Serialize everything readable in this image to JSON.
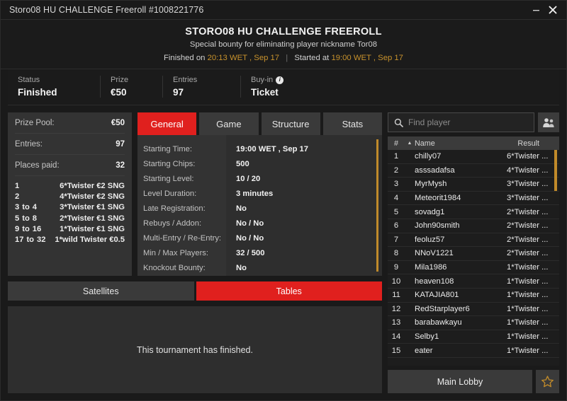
{
  "window": {
    "title": "Storo08 HU CHALLENGE Freeroll #1008221776",
    "minimize_label": "minimize",
    "close_label": "close"
  },
  "header": {
    "title": "STORO08 HU CHALLENGE FREEROLL",
    "subtitle": "Special bounty for eliminating player nickname Tor08",
    "finished_prefix": "Finished on",
    "finished_value": "20:13 WET , Sep 17",
    "separator": "|",
    "started_prefix": "Started at",
    "started_value": "19:00 WET , Sep 17"
  },
  "status_strip": [
    {
      "label": "Status",
      "value": "Finished",
      "has_info": false
    },
    {
      "label": "Prize",
      "value": "€50",
      "has_info": false
    },
    {
      "label": "Entries",
      "value": "97",
      "has_info": false
    },
    {
      "label": "Buy-in",
      "value": "Ticket",
      "has_info": true
    }
  ],
  "prize_panel": {
    "rows": [
      {
        "key": "Prize Pool:",
        "value": "€50"
      },
      {
        "key": "Entries:",
        "value": "97"
      },
      {
        "key": "Places paid:",
        "value": "32"
      }
    ],
    "payouts": [
      {
        "from": "1",
        "to_word": "",
        "to": "",
        "prize": "6*Twister €2 SNG"
      },
      {
        "from": "2",
        "to_word": "",
        "to": "",
        "prize": "4*Twister €2 SNG"
      },
      {
        "from": "3",
        "to_word": "to",
        "to": "4",
        "prize": "3*Twister €1 SNG"
      },
      {
        "from": "5",
        "to_word": "to",
        "to": "8",
        "prize": "2*Twister €1 SNG"
      },
      {
        "from": "9",
        "to_word": "to",
        "to": "16",
        "prize": "1*Twister €1 SNG"
      },
      {
        "from": "17",
        "to_word": "to",
        "to": "32",
        "prize": "1*wild Twister €0.5"
      }
    ]
  },
  "tabs": [
    {
      "label": "General",
      "active": true
    },
    {
      "label": "Game",
      "active": false
    },
    {
      "label": "Structure",
      "active": false
    },
    {
      "label": "Stats",
      "active": false
    }
  ],
  "details": [
    {
      "label": "Starting Time:",
      "value": "19:00 WET , Sep 17"
    },
    {
      "label": "Starting Chips:",
      "value": "500"
    },
    {
      "label": "Starting Level:",
      "value": "10 / 20"
    },
    {
      "label": "Level Duration:",
      "value": "3 minutes"
    },
    {
      "label": "Late Registration:",
      "value": "No"
    },
    {
      "label": "Rebuys / Addon:",
      "value": "No / No"
    },
    {
      "label": "Multi-Entry / Re-Entry:",
      "value": "No / No"
    },
    {
      "label": "Min / Max Players:",
      "value": "32 / 500"
    },
    {
      "label": "Knockout Bounty:",
      "value": "No"
    }
  ],
  "sub_tabs": [
    {
      "label": "Satellites",
      "active": false
    },
    {
      "label": "Tables",
      "active": true
    }
  ],
  "tables_panel": {
    "message": "This tournament has finished."
  },
  "search": {
    "placeholder": "Find player",
    "value": ""
  },
  "player_table": {
    "headers": {
      "num": "#",
      "sort_arrow": "▲",
      "name": "Name",
      "result": "Result"
    },
    "rows": [
      {
        "num": "1",
        "name": "chilly07",
        "result": "6*Twister ..."
      },
      {
        "num": "2",
        "name": "asssadafsa",
        "result": "4*Twister ..."
      },
      {
        "num": "3",
        "name": "MyrMysh",
        "result": "3*Twister ..."
      },
      {
        "num": "4",
        "name": "Meteorit1984",
        "result": "3*Twister ..."
      },
      {
        "num": "5",
        "name": "sovadg1",
        "result": "2*Twister ..."
      },
      {
        "num": "6",
        "name": "John90smith",
        "result": "2*Twister ..."
      },
      {
        "num": "7",
        "name": "feoluz57",
        "result": "2*Twister ..."
      },
      {
        "num": "8",
        "name": "NNoV1221",
        "result": "2*Twister ..."
      },
      {
        "num": "9",
        "name": "Mila1986",
        "result": "1*Twister ..."
      },
      {
        "num": "10",
        "name": "heaven108",
        "result": "1*Twister ..."
      },
      {
        "num": "11",
        "name": "KATAJIA801",
        "result": "1*Twister ..."
      },
      {
        "num": "12",
        "name": "RedStarplayer6",
        "result": "1*Twister ..."
      },
      {
        "num": "13",
        "name": "barabawkayu",
        "result": "1*Twister ..."
      },
      {
        "num": "14",
        "name": "Selby1",
        "result": "1*Twister ..."
      },
      {
        "num": "15",
        "name": "eater",
        "result": "1*Twister ..."
      }
    ]
  },
  "footer": {
    "lobby_label": "Main Lobby",
    "favourite_icon": "star-icon"
  },
  "colors": {
    "accent_red": "#e0201e",
    "accent_gold": "#c08a2a",
    "panel_bg": "#333333",
    "window_bg": "#1a1a1a"
  }
}
